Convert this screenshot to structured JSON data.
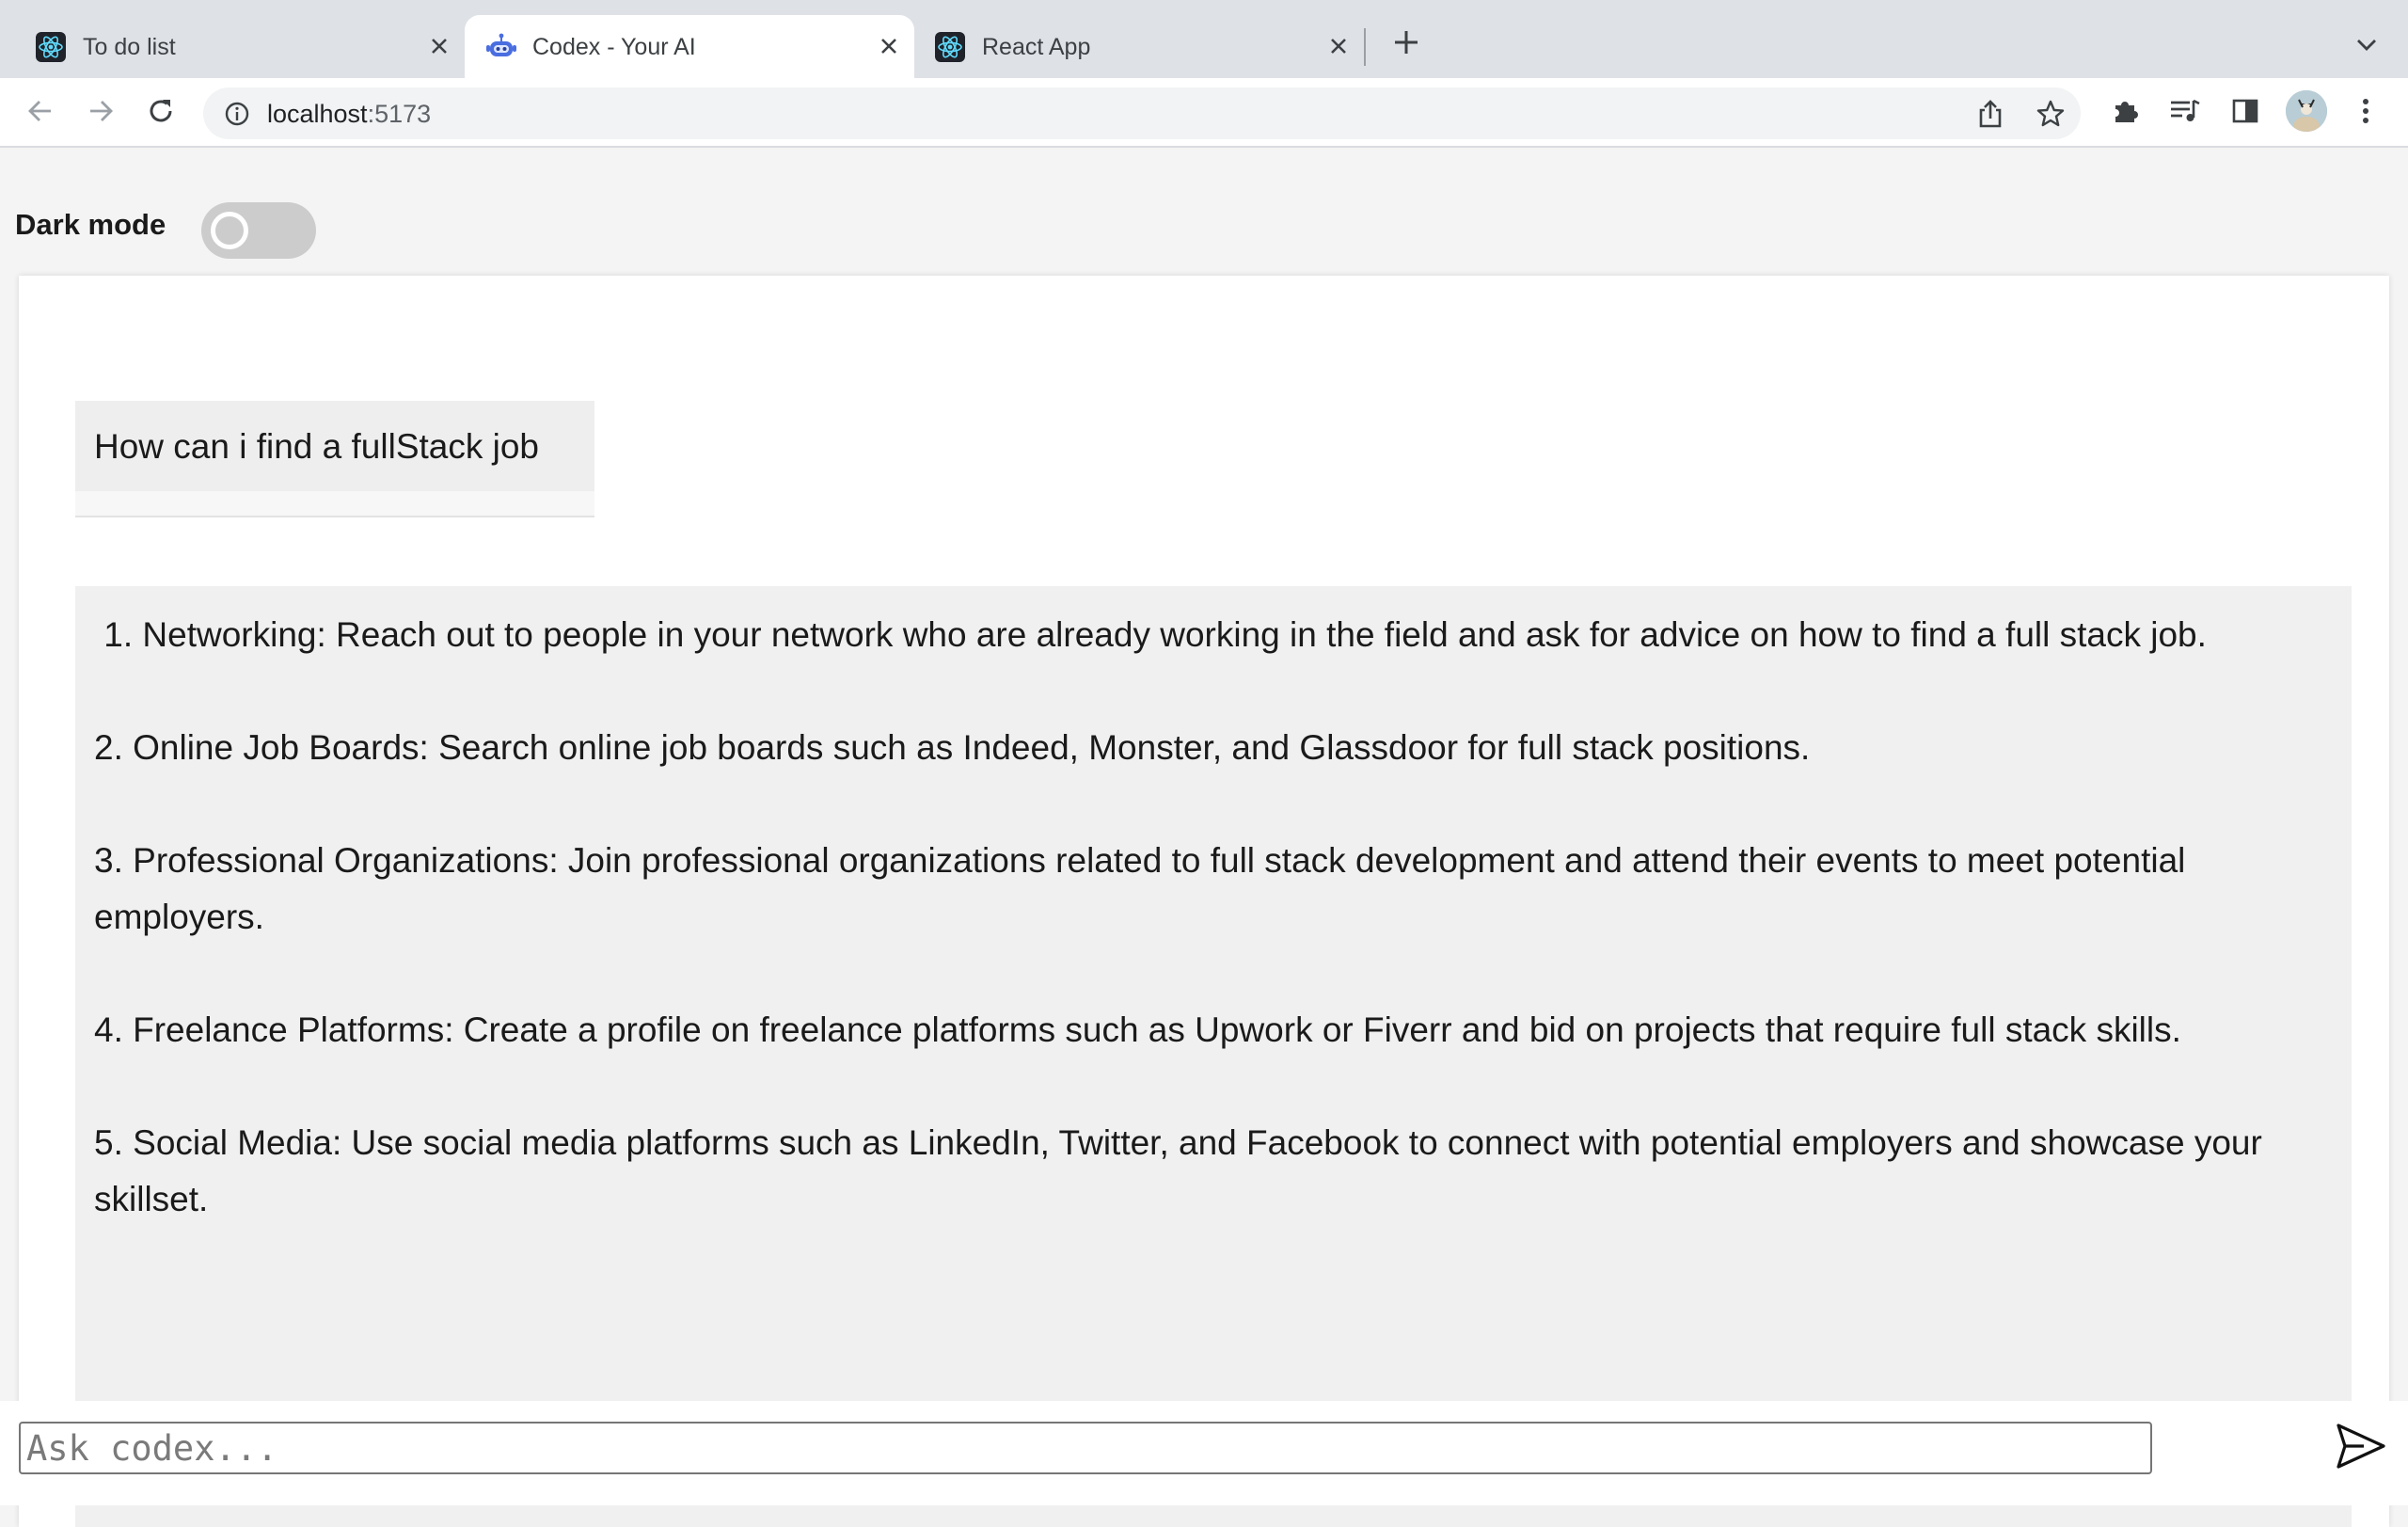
{
  "browser": {
    "tabs": [
      {
        "title": "To do list",
        "icon": "react-icon",
        "active": false
      },
      {
        "title": "Codex - Your AI",
        "icon": "robot-icon",
        "active": true
      },
      {
        "title": "React App",
        "icon": "react-icon",
        "active": false
      }
    ],
    "url_host": "localhost",
    "url_port": ":5173"
  },
  "settings": {
    "dark_mode_label": "Dark mode",
    "dark_mode_enabled": false
  },
  "chat": {
    "user_message": "How can i find a fullStack job",
    "ai_items": [
      " 1. Networking: Reach out to people in your network who are already working in the field and ask for advice on how to find a full stack job.",
      "2. Online Job Boards: Search online job boards such as Indeed, Monster, and Glassdoor for full stack positions.",
      "3. Professional Organizations: Join professional organizations related to full stack development and attend their events to meet potential employers.",
      "4. Freelance Platforms: Create a profile on freelance platforms such as Upwork or Fiverr and bid on projects that require full stack skills.",
      "5. Social Media: Use social media platforms such as LinkedIn, Twitter, and Facebook to connect with potential employers and showcase your skillset."
    ]
  },
  "composer": {
    "placeholder": "Ask codex...",
    "value": ""
  }
}
